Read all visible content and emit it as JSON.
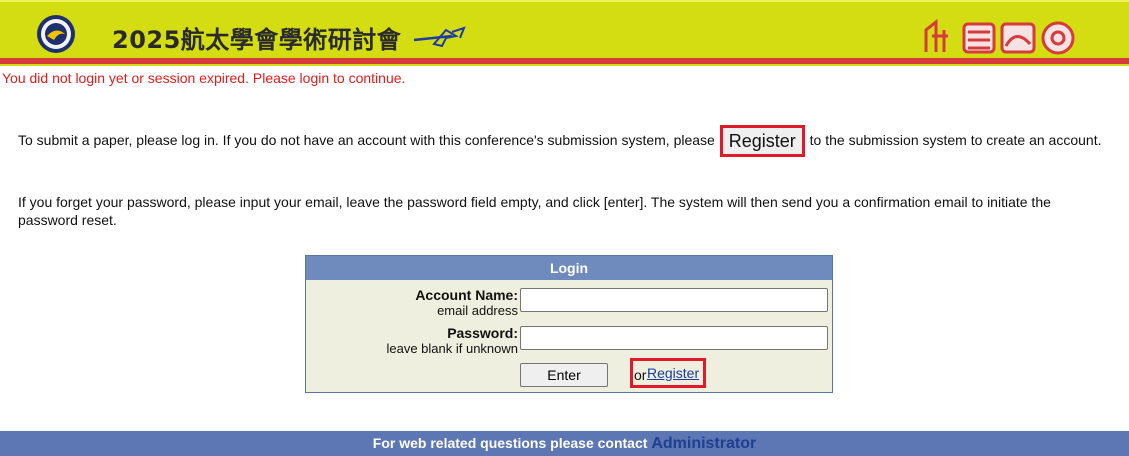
{
  "header": {
    "title": "2025航太學會學術研討會",
    "colors": {
      "banner": "#d4dc12",
      "stripe": "#d63a3a"
    }
  },
  "session_message": "You did not login yet or session expired. Please login to continue.",
  "intro": {
    "before_register": "To submit a paper, please log in. If you do not have an account with this conference's submission system, please",
    "register_button": "Register",
    "after_register": "to the submission system to create an account."
  },
  "forgot_text": "If you forget your password, please input your email, leave the password field empty, and click [enter]. The system will then send you a confirmation email to initiate the password reset.",
  "login": {
    "title": "Login",
    "account_label": "Account Name:",
    "account_hint": "email address",
    "account_value": "",
    "password_label": "Password:",
    "password_hint": "leave blank if unknown",
    "password_value": "",
    "enter_label": "Enter",
    "or_text": "or",
    "register_link": "Register"
  },
  "footer": {
    "text": "For web related questions please contact",
    "admin_link": "Administrator"
  }
}
